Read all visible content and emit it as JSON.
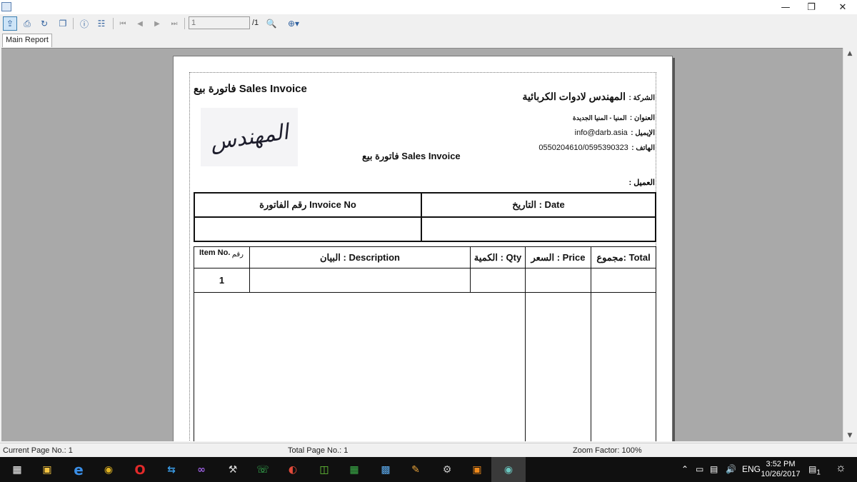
{
  "toolbar": {
    "page_value": "1",
    "page_of": "/1"
  },
  "tabs": {
    "main_report": "Main Report"
  },
  "report": {
    "header_title": "فاتورة بيع Sales Invoice",
    "middle_title": "فاتورة بيع Sales Invoice",
    "logo_text": "المهندس",
    "company_label": "الشركة :",
    "company_value": "المهندس لادوات الكربائية",
    "address_label": "العنوان :",
    "address_value": "المنيا - المنيا الجديدة",
    "email_label": "الإيميل :",
    "email_value": "info@darb.asia",
    "phone_label": "الهاتف :",
    "phone_value": "0550204610/0595390323",
    "client_label": "العميل :",
    "invoice_no_label": "رقم الفاتورة Invoice No",
    "date_label": "التاريخ  : Date",
    "item_no_en": "Item No.",
    "item_no_ar": "رقم",
    "description_label": "البيان : Description",
    "qty_label": "الكمية : Qty",
    "price_label": "السعر : Price",
    "total_label": "مجموع: Total",
    "row_number": "1"
  },
  "status": {
    "current_page": "Current Page No.: 1",
    "total_page": "Total Page No.: 1",
    "zoom": "Zoom Factor: 100%"
  },
  "taskbar": {
    "language": "ENG",
    "time": "3:52 PM",
    "date": "10/26/2017",
    "notification_count": "1"
  }
}
